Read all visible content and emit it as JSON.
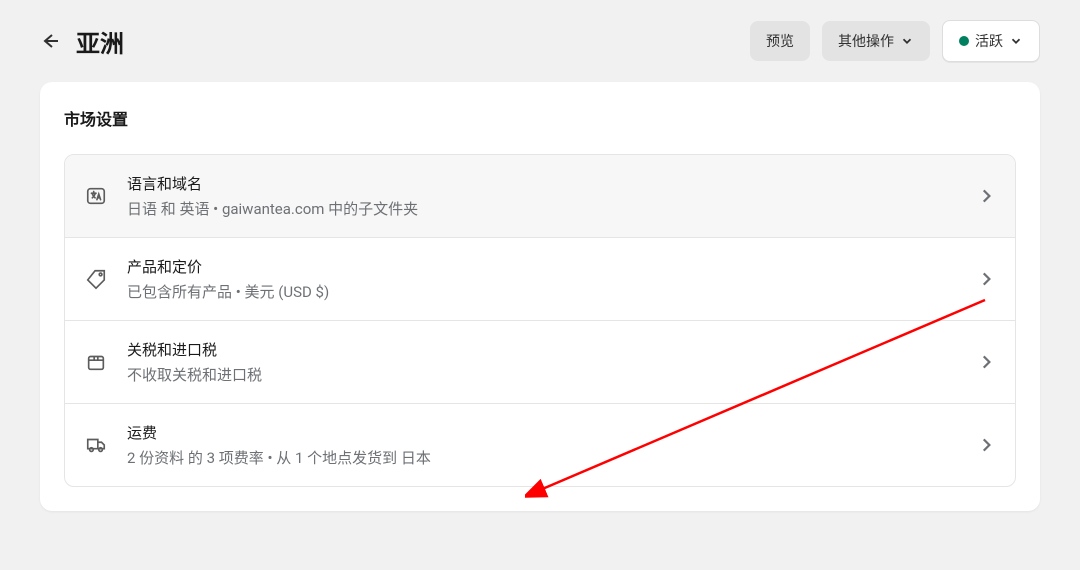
{
  "header": {
    "title": "亚洲",
    "preview_label": "预览",
    "other_actions_label": "其他操作",
    "status_label": "活跃"
  },
  "card": {
    "title": "市场设置"
  },
  "settings": [
    {
      "title": "语言和域名",
      "subtitle": "日语 和 英语 • gaiwantea.com 中的子文件夹"
    },
    {
      "title": "产品和定价",
      "subtitle": "已包含所有产品 • 美元 (USD $)"
    },
    {
      "title": "关税和进口税",
      "subtitle": "不收取关税和进口税"
    },
    {
      "title": "运费",
      "subtitle": "2 份资料 的 3 项费率 • 从 1 个地点发货到 日本"
    }
  ]
}
